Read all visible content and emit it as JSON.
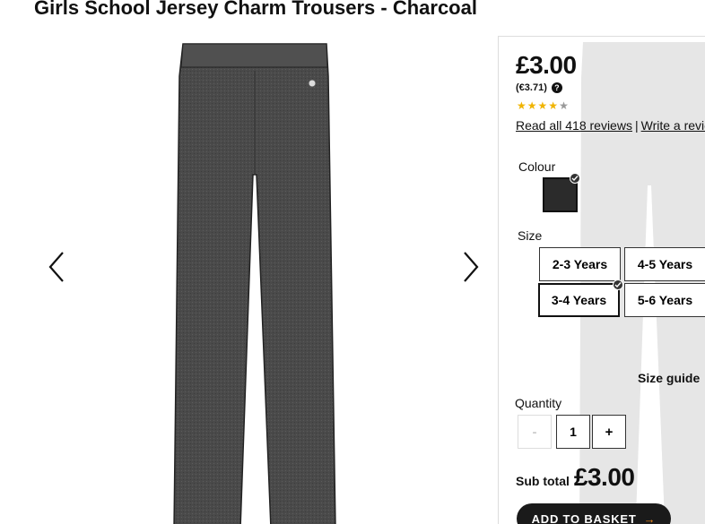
{
  "product": {
    "title": "Girls School Jersey Charm Trousers - Charcoal"
  },
  "pricing": {
    "price": "£3.00",
    "euro_price": "(€3.71)",
    "rating": 4,
    "rating_max": 5,
    "reviews_link": "Read all 418 reviews",
    "separator": "|",
    "write_review_link": "Write a review"
  },
  "colour": {
    "label": "Colour",
    "selected_swatch": "#2b2b2b"
  },
  "size": {
    "label": "Size",
    "options": [
      "2-3 Years",
      "4-5 Years",
      "3-4 Years",
      "5-6 Years"
    ],
    "selected": "3-4 Years",
    "guide_link": "Size guide"
  },
  "quantity": {
    "label": "Quantity",
    "decrement": "-",
    "value": "1",
    "increment": "+"
  },
  "subtotal": {
    "label": "Sub total",
    "value": "£3.00"
  },
  "cta": {
    "add_to_basket": "ADD TO BASKET",
    "arrow": "→"
  },
  "colors": {
    "accent_arrow": "#f08c1e",
    "button_bg": "#1a1a1a",
    "star_on": "#f0b400",
    "star_off": "#999999"
  },
  "icons": [
    "chevron-left-icon",
    "chevron-right-icon",
    "help-icon",
    "star-icon",
    "checkmark-icon",
    "arrow-right-icon"
  ]
}
